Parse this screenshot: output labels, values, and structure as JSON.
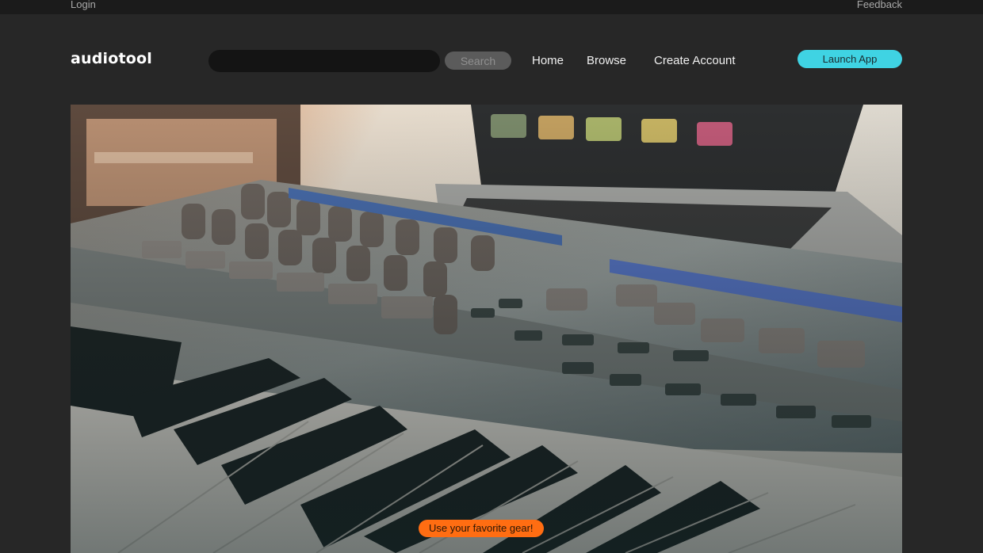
{
  "topbar": {
    "login": "Login",
    "feedback": "Feedback"
  },
  "header": {
    "logo": "audiotool",
    "search": {
      "value": "",
      "placeholder": "",
      "button": "Search"
    },
    "nav": [
      "Home",
      "Browse",
      "Create Account"
    ],
    "launch_button": "Launch App"
  },
  "hero": {
    "caption": "Use your favorite gear!",
    "image_subject": "MIDI keyboard controller with knobs, pads and faders in front of a laptop"
  },
  "colors": {
    "background": "#272727",
    "topbar": "#1b1b1b",
    "accent": "#3fd3e3",
    "caption": "#ff6d12"
  }
}
